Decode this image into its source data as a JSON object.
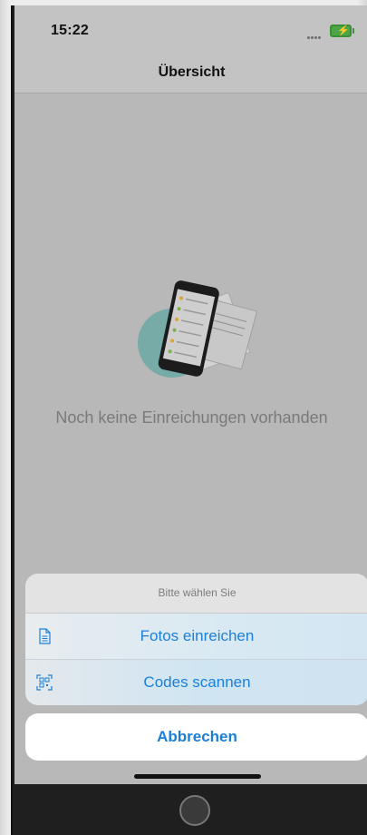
{
  "status_bar": {
    "time": "15:22",
    "signal_icon": "signal-dots-icon",
    "battery_icon": "battery-charging-icon",
    "battery_color": "#4ca646"
  },
  "nav": {
    "title": "Übersicht"
  },
  "main": {
    "empty_illustration": "phone-documents-illustration",
    "empty_text": "Noch keine Einreichungen vorhanden"
  },
  "action_sheet": {
    "title": "Bitte wählen Sie",
    "options": [
      {
        "label": "Fotos einreichen",
        "icon": "document-icon"
      },
      {
        "label": "Codes scannen",
        "icon": "qr-scan-icon"
      }
    ],
    "cancel_label": "Abbrechen",
    "accent_color": "#1b7fd8"
  }
}
